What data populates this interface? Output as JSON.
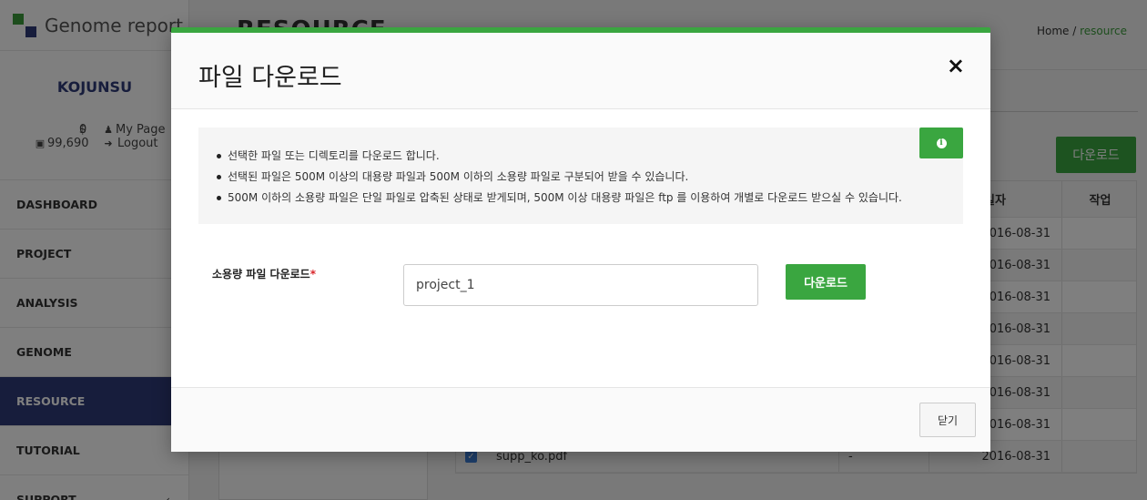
{
  "app": {
    "brand": "Genome report"
  },
  "user": {
    "name": "KOJUNSU",
    "balance": "0",
    "points": "99,690",
    "my_page": "My Page",
    "logout": "Logout"
  },
  "nav": [
    {
      "label": "DASHBOARD"
    },
    {
      "label": "PROJECT"
    },
    {
      "label": "ANALYSIS"
    },
    {
      "label": "GENOME"
    },
    {
      "label": "RESOURCE",
      "active": true
    },
    {
      "label": "TUTORIAL"
    },
    {
      "label": "SUPPORT"
    }
  ],
  "page": {
    "title": "RESOURCE",
    "breadcrumb": {
      "home": "Home",
      "sep": "/",
      "current": "resource"
    },
    "download_label": "다운로드"
  },
  "table": {
    "headers": {
      "date": "일자",
      "action": "작업"
    },
    "dates": [
      "2016-08-31",
      "2016-08-31",
      "2016-08-31",
      "2016-08-31",
      "2016-08-31",
      "2016-08-31",
      "2016-08-31"
    ],
    "last_row": {
      "name": "supp_ko.pdf",
      "size": "-",
      "date": "2016-08-31"
    }
  },
  "modal": {
    "title": "파일 다운로드",
    "close_icon": "×",
    "info": [
      "선택한 파일 또는 디렉토리를 다운로드 합니다.",
      "선택된 파일은 500M 이상의 대용량 파일과 500M 이하의 소용량 파일로 구분되어 받을 수 있습니다.",
      "500M 이하의 소용량 파일은 단일 파일로 압축된 상태로 받게되며, 500M 이상 대용량 파일은 ftp 를 이용하여 개별로 다운로드 받으실 수 있습니다."
    ],
    "form_label": "소용량 파일 다운로드",
    "required_mark": "*",
    "input_value": "project_1",
    "download_button": "다운로드",
    "close_button": "닫기"
  },
  "colors": {
    "accent": "#3aa640",
    "nav_active": "#2e3a78"
  }
}
